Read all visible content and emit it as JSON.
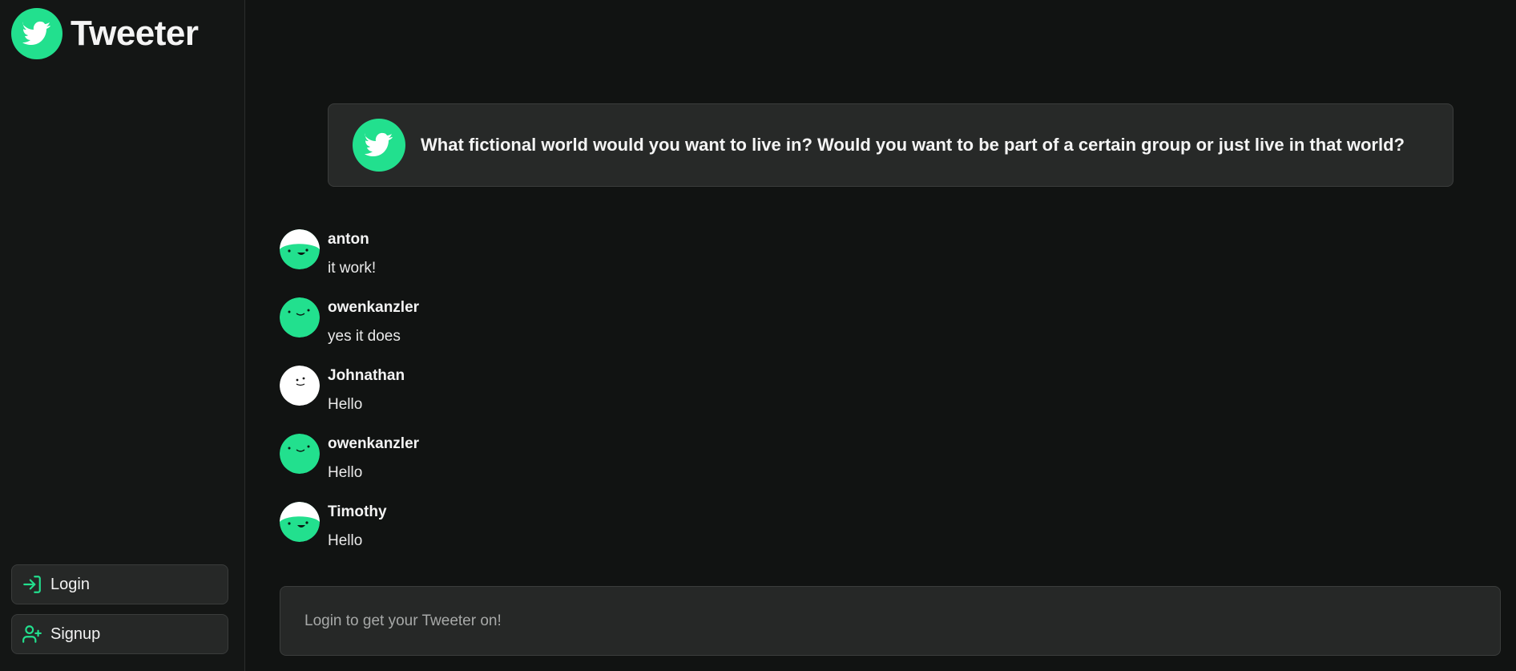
{
  "app": {
    "name": "Tweeter",
    "logo_icon": "bird-icon",
    "accent": "#22e08e"
  },
  "sidebar": {
    "login_label": "Login",
    "signup_label": "Signup"
  },
  "prompt": {
    "text": "What fictional world would you want to live in? Would you want to be part of a certain group or just live in that world?"
  },
  "messages": [
    {
      "user": "anton",
      "text": "it work!",
      "avatar": "green-face-white-top"
    },
    {
      "user": "owenkanzler",
      "text": "yes it does",
      "avatar": "green-face"
    },
    {
      "user": "Johnathan",
      "text": "Hello",
      "avatar": "white-face"
    },
    {
      "user": "owenkanzler",
      "text": "Hello",
      "avatar": "green-face"
    },
    {
      "user": "Timothy",
      "text": "Hello",
      "avatar": "green-face-white-top"
    }
  ],
  "composer": {
    "placeholder": "Login to get your Tweeter on!"
  }
}
